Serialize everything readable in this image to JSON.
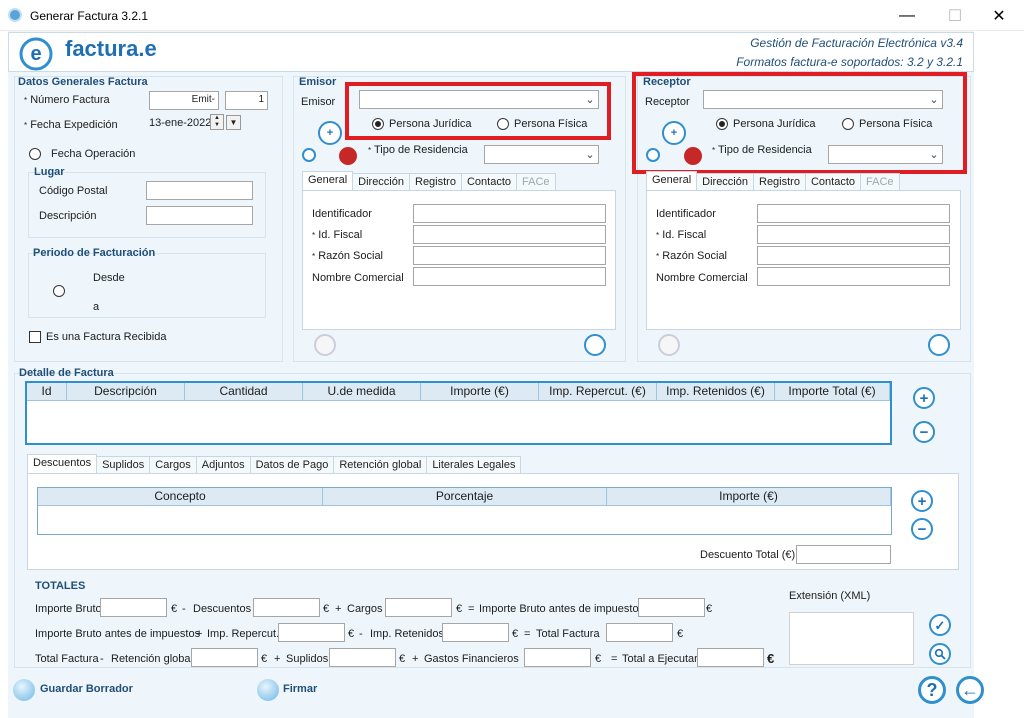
{
  "window": {
    "title": "Generar Factura 3.2.1",
    "minimize": "—",
    "maximize": "☐",
    "close": "✕"
  },
  "header": {
    "brand": "factura.e",
    "line1": "Gestión de Facturación Electrónica v3.4",
    "line2": "Formatos factura-e soportados: 3.2 y 3.2.1"
  },
  "general": {
    "title": "Datos Generales Factura",
    "numero_label": "Número Factura",
    "serie_value": "Emit-",
    "numero_value": "1",
    "fecha_exp_label": "Fecha Expedición",
    "fecha_exp_value": "13-ene-2022",
    "fecha_op_label": "Fecha Operación",
    "lugar_title": "Lugar",
    "cp_label": "Código Postal",
    "desc_label": "Descripción",
    "periodo_title": "Periodo de Facturación",
    "desde_label": "Desde",
    "a_label": "a",
    "recibida_label": "Es una Factura Recibida"
  },
  "emisor": {
    "title": "Emisor",
    "combo_label": "Emisor",
    "juridica": "Persona Jurídica",
    "fisica": "Persona Física",
    "residencia_label": "Tipo de Residencia"
  },
  "receptor": {
    "title": "Receptor",
    "combo_label": "Receptor",
    "juridica": "Persona Jurídica",
    "fisica": "Persona Física",
    "residencia_label": "Tipo de Residencia"
  },
  "party_tabs": [
    "General",
    "Dirección",
    "Registro",
    "Contacto",
    "FACe"
  ],
  "party_fields": {
    "identificador": "Identificador",
    "id_fiscal": "Id. Fiscal",
    "razon_social": "Razón Social",
    "nombre_comercial": "Nombre Comercial"
  },
  "detalle": {
    "title": "Detalle de Factura",
    "columns": [
      "Id",
      "Descripción",
      "Cantidad",
      "U.de medida",
      "Importe (€)",
      "Imp. Repercut. (€)",
      "Imp. Retenidos (€)",
      "Importe Total (€)"
    ]
  },
  "sub_tabs": [
    "Descuentos",
    "Suplidos",
    "Cargos",
    "Adjuntos",
    "Datos de Pago",
    "Retención global",
    "Literales Legales"
  ],
  "descuentos": {
    "columns": [
      "Concepto",
      "Porcentaje",
      "Importe (€)"
    ],
    "total_label": "Descuento Total (€)"
  },
  "totales": {
    "title": "TOTALES",
    "importe_bruto": "Importe Bruto",
    "eur": "€",
    "minus": "-",
    "plus": "+",
    "equals": "=",
    "descuentos": "Descuentos",
    "cargos": "Cargos",
    "bruto_antes": "Importe Bruto antes de impuestos",
    "imp_repercut": "Imp. Repercut.",
    "imp_retenidos": "Imp. Retenidos",
    "total_factura": "Total Factura",
    "retencion_global": "Retención global",
    "suplidos": "Suplidos",
    "gastos_financieros": "Gastos Financieros",
    "total_ejecutar": "Total a Ejecutar",
    "extension": "Extensión (XML)"
  },
  "footer": {
    "guardar": "Guardar Borrador",
    "firmar": "Firmar"
  },
  "symbols": {
    "add": "+",
    "remove": "−",
    "help": "?",
    "back": "←",
    "check": "✓",
    "arrow": "⌄",
    "spin_up": "▲",
    "spin_down": "▼",
    "dropdown": "▼",
    "asterisk": "*"
  },
  "colors": {
    "accent": "#1f4e79",
    "highlight": "#e11d24",
    "panel": "#eef6fb",
    "grid_border": "#2f8fcf"
  }
}
